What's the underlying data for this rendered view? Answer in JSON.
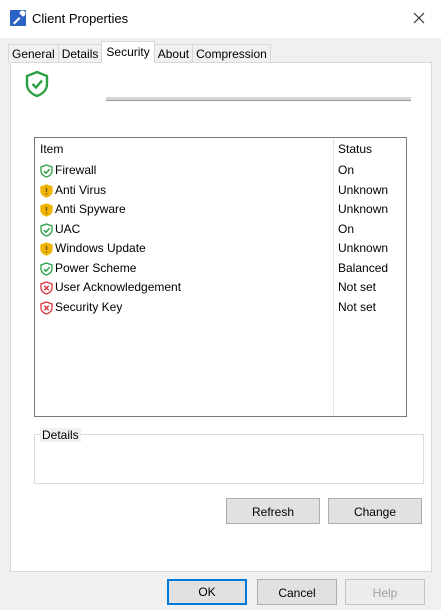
{
  "window": {
    "title": "Client Properties",
    "app_icon": "wrench-icon",
    "close_icon": "close-icon"
  },
  "tabs": [
    {
      "label": "General",
      "active": false
    },
    {
      "label": "Details",
      "active": false
    },
    {
      "label": "Security",
      "active": true
    },
    {
      "label": "About",
      "active": false
    },
    {
      "label": "Compression",
      "active": false
    }
  ],
  "security": {
    "header_icon": "shield-check-icon",
    "list": {
      "columns": {
        "item": "Item",
        "status": "Status"
      },
      "rows": [
        {
          "name": "Firewall",
          "status": "On",
          "icon": "shield-check-icon",
          "state": "ok"
        },
        {
          "name": "Anti Virus",
          "status": "Unknown",
          "icon": "shield-warning-icon",
          "state": "warn"
        },
        {
          "name": "Anti Spyware",
          "status": "Unknown",
          "icon": "shield-warning-icon",
          "state": "warn"
        },
        {
          "name": "UAC",
          "status": "On",
          "icon": "shield-check-icon",
          "state": "ok"
        },
        {
          "name": "Windows Update",
          "status": "Unknown",
          "icon": "shield-warning-icon",
          "state": "warn"
        },
        {
          "name": "Power Scheme",
          "status": "Balanced",
          "icon": "shield-check-icon",
          "state": "ok"
        },
        {
          "name": "User Acknowledgement",
          "status": "Not set",
          "icon": "shield-x-icon",
          "state": "error"
        },
        {
          "name": "Security Key",
          "status": "Not set",
          "icon": "shield-x-icon",
          "state": "error"
        }
      ]
    },
    "details_label": "Details",
    "refresh_label": "Refresh",
    "change_label": "Change"
  },
  "footer": {
    "ok_label": "OK",
    "cancel_label": "Cancel",
    "help_label": "Help"
  },
  "colors": {
    "ok": "#2aa043",
    "warn": "#f0b400",
    "error": "#d9363e",
    "accent": "#0078d7"
  }
}
